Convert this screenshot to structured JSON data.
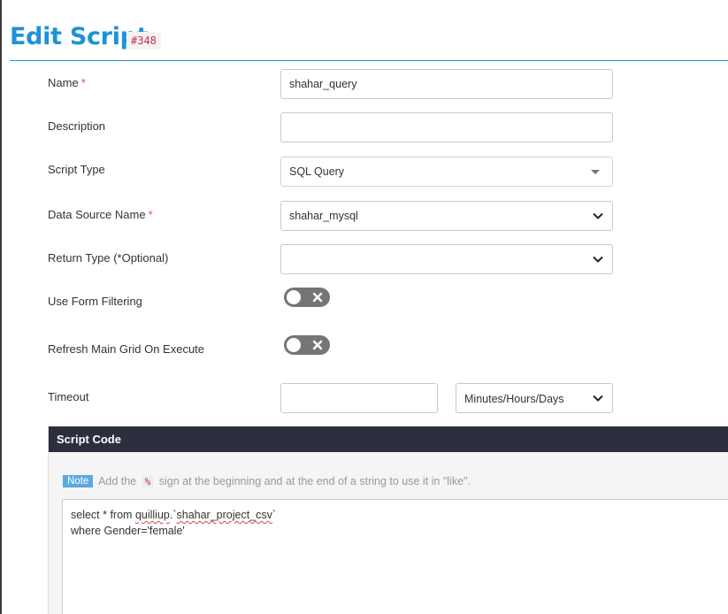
{
  "page": {
    "title": "Edit Script",
    "id_badge": "#348"
  },
  "form": {
    "name": {
      "label": "Name",
      "required_mark": "*",
      "value": "shahar_query"
    },
    "description": {
      "label": "Description",
      "value": ""
    },
    "script_type": {
      "label": "Script Type",
      "value": "SQL Query"
    },
    "data_source": {
      "label": "Data Source Name",
      "required_mark": "*",
      "value": "shahar_mysql"
    },
    "return_type": {
      "label": "Return Type (*Optional)",
      "value": ""
    },
    "use_form_filtering": {
      "label": "Use Form Filtering",
      "enabled": false
    },
    "refresh_main_grid": {
      "label": "Refresh Main Grid On Execute",
      "enabled": false
    },
    "timeout": {
      "label": "Timeout",
      "value": "",
      "unit": "Minutes/Hours/Days"
    }
  },
  "script_code": {
    "header": "Script Code",
    "note_tag": "Note",
    "note_before": "Add the",
    "note_symbol": "%",
    "note_after": "sign at the beginning and at the end of a string to use it in \"like\".",
    "line1_a": "select * from ",
    "line1_b": "quilliup",
    "line1_c": ".`",
    "line1_d": "shahar_project_csv",
    "line1_e": "`",
    "line2": "where Gender='female'"
  },
  "colors": {
    "accent": "#1e93d6",
    "header_dark": "#2c2f3d",
    "toggle_off": "#757575",
    "required": "#d9534f",
    "note_tag": "#5aa9df"
  }
}
